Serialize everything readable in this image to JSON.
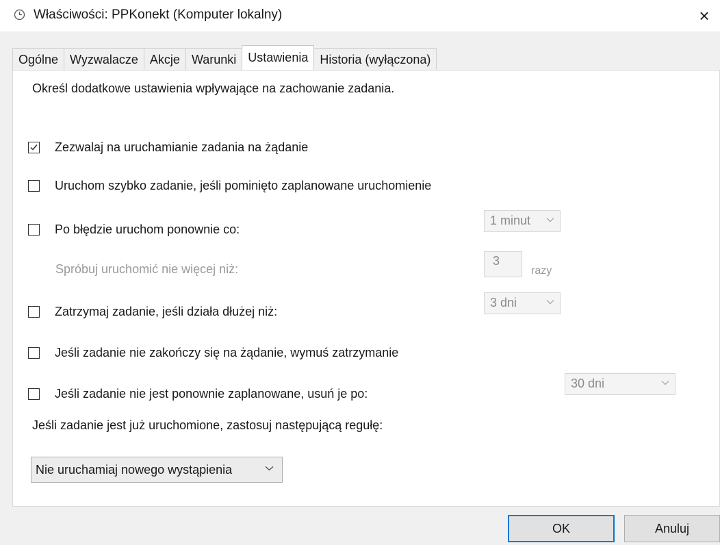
{
  "window": {
    "title": "Właściwości: PPKonekt (Komputer lokalny)",
    "close_glyph": "×",
    "icon": "clock-icon"
  },
  "tabs": [
    {
      "label": "Ogólne",
      "active": false
    },
    {
      "label": "Wyzwalacze",
      "active": false
    },
    {
      "label": "Akcje",
      "active": false
    },
    {
      "label": "Warunki",
      "active": false
    },
    {
      "label": "Ustawienia",
      "active": true
    },
    {
      "label": "Historia (wyłączona)",
      "active": false
    }
  ],
  "settings": {
    "description": "Określ dodatkowe ustawienia wpływające na zachowanie zadania.",
    "allow_on_demand": {
      "label": "Zezwalaj na uruchamianie zadania na żądanie",
      "checked": true
    },
    "run_missed": {
      "label": "Uruchom szybko zadanie, jeśli pominięto zaplanowane uruchomienie",
      "checked": false
    },
    "restart_on_fail": {
      "label": "Po błędzie uruchom ponownie co:",
      "checked": false,
      "interval": "1 minut"
    },
    "retry": {
      "label": "Spróbuj uruchomić nie więcej niż:",
      "count": "3",
      "unit": "razy"
    },
    "stop_long": {
      "label": "Zatrzymaj zadanie, jeśli działa dłużej niż:",
      "checked": false,
      "duration": "3 dni"
    },
    "force_stop": {
      "label": "Jeśli zadanie nie zakończy się na żądanie, wymuś zatrzymanie",
      "checked": false
    },
    "delete_after": {
      "label": "Jeśli zadanie nie jest ponownie zaplanowane, usuń je po:",
      "checked": false,
      "duration": "30 dni"
    },
    "rule_label": "Jeśli zadanie jest już uruchomione, zastosuj następującą regułę:",
    "rule_value": "Nie uruchamiaj nowego wystąpienia"
  },
  "buttons": {
    "ok": "OK",
    "cancel": "Anuluj"
  }
}
